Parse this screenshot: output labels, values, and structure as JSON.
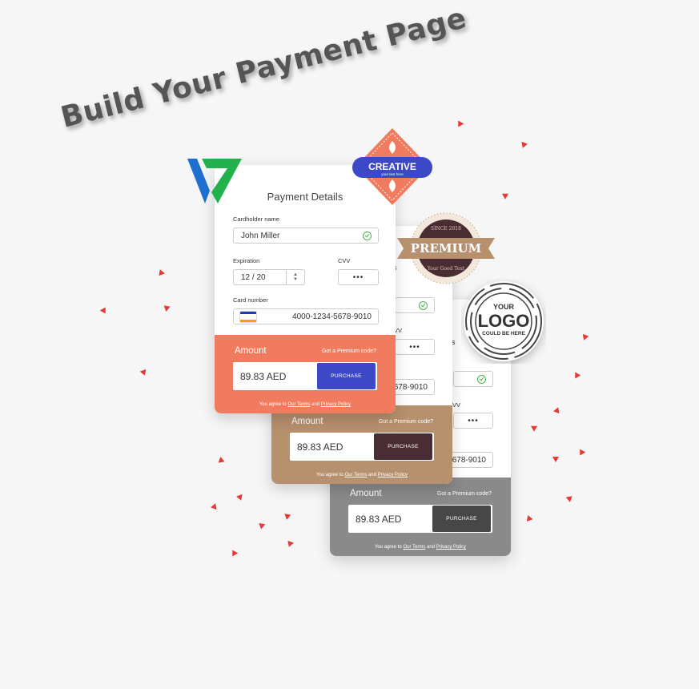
{
  "headline": "Build Your Payment Page",
  "form": {
    "title": "Payment Details",
    "cardholder_label": "Cardholder name",
    "cardholder_value": "John Miller",
    "expiration_label": "Expiration",
    "expiration_value": "12 / 20",
    "cvv_label": "CVV",
    "cvv_value": "•••",
    "card_number_label": "Card number",
    "card_number_value": "4000-1234-5678-9010",
    "card_brand": "VISA",
    "amount_label": "Amount",
    "promo_link": "Got a Premium code?",
    "amount_value": "89.83 AED",
    "purchase_button": "PURCHASE",
    "terms_prefix": "You agree to",
    "terms_link": "Our Terms",
    "terms_and": "and",
    "privacy_link": "Privacy Policy"
  },
  "peek": {
    "s": "s",
    "cvv": "VV",
    "number_tail": "678-9010"
  },
  "badges": {
    "creative_title": "CREATIVE",
    "creative_sub": "your text here",
    "premium_title": "PREMIUM",
    "premium_top": "SINCE 2018",
    "premium_bottom": "Your Good Text",
    "logo_line1": "YOUR",
    "logo_line2": "LOGO",
    "logo_line3": "COULD BE HERE"
  },
  "colors": {
    "coral": "#f07b5f",
    "brown": "#b7906e",
    "grey": "#8a8a8a",
    "accent_blue": "#3d48c7",
    "confetti": "#e53935"
  }
}
